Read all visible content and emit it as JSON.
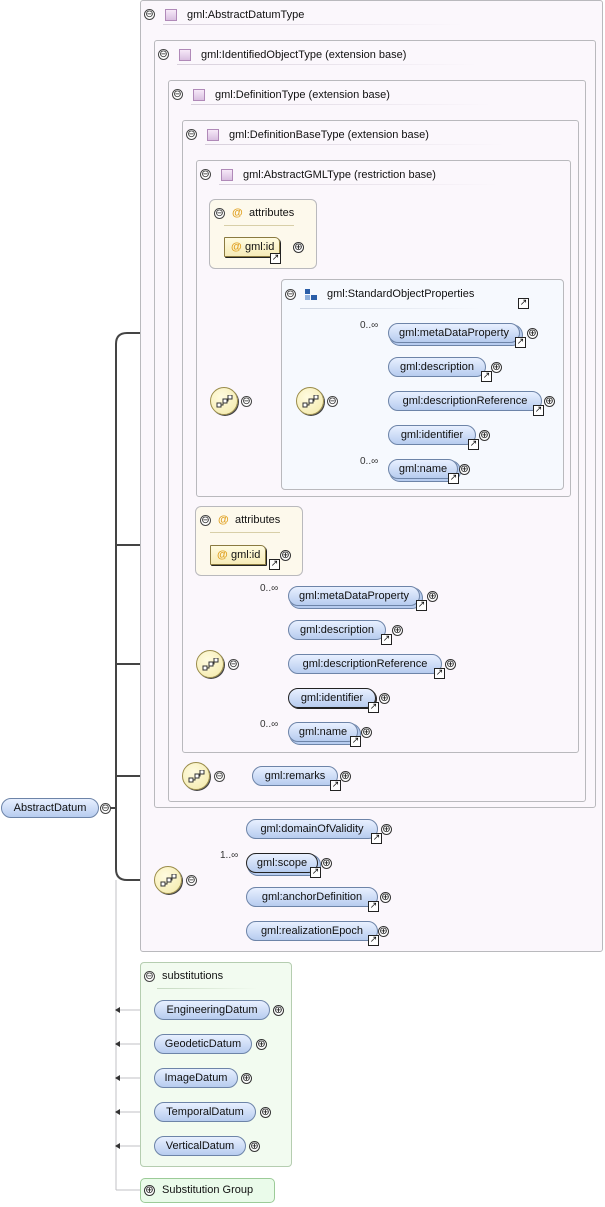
{
  "diagram": {
    "root": {
      "label": "AbstractDatum"
    },
    "types": {
      "abstract_datum_type": "gml:AbstractDatumType",
      "identified_object_type": "gml:IdentifiedObjectType (extension base)",
      "definition_type": "gml:DefinitionType (extension base)",
      "definition_base_type": "gml:DefinitionBaseType (extension base)",
      "abstract_gml_type": "gml:AbstractGMLType (restriction base)"
    },
    "attributes_label": "attributes",
    "attr_id": "gml:id",
    "group_name": "gml:StandardObjectProperties",
    "cardinality": {
      "zero_many": "0..∞",
      "one_many": "1..∞"
    },
    "group_elements": [
      "gml:metaDataProperty",
      "gml:description",
      "gml:descriptionReference",
      "gml:identifier",
      "gml:name"
    ],
    "base_elements": [
      "gml:metaDataProperty",
      "gml:description",
      "gml:descriptionReference",
      "gml:identifier",
      "gml:name"
    ],
    "definition_elements": [
      "gml:remarks"
    ],
    "datum_elements": [
      "gml:domainOfValidity",
      "gml:scope",
      "gml:anchorDefinition",
      "gml:realizationEpoch"
    ],
    "substitutions_label": "substitutions",
    "substitutions": [
      "EngineeringDatum",
      "GeodeticDatum",
      "ImageDatum",
      "TemporalDatum",
      "VerticalDatum"
    ],
    "substitution_group_label": "Substitution Group",
    "icons": {
      "toggle_open": "⊖",
      "toggle_closed": "⊕",
      "ref": "↗",
      "attr": "@"
    }
  }
}
